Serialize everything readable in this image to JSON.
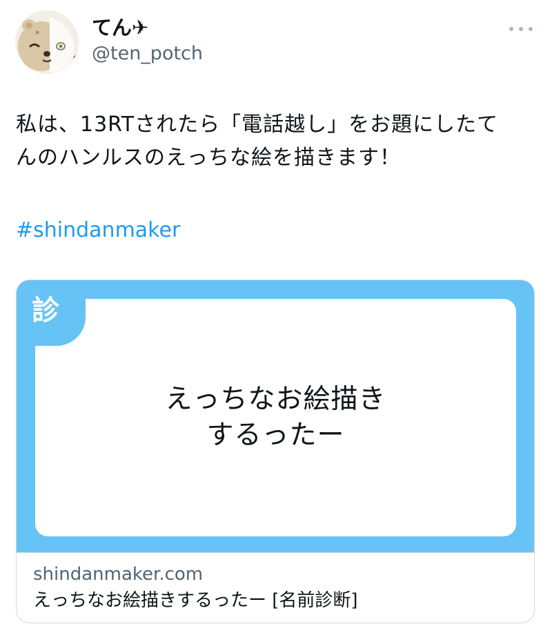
{
  "author": {
    "display_name": "てん✈",
    "handle": "@ten_potch",
    "avatar_icon": "bear-avatar-icon"
  },
  "more_icon": "ellipsis-icon",
  "tweet": {
    "text_line_1": "私は、13RTされたら「電話越し」をお題にしたて",
    "text_line_2": "んのハンルスのえっちな絵を描きます！",
    "hashtag": "#shindanmaker"
  },
  "card": {
    "badge": "診",
    "image_title_line_1": "えっちなお絵描き",
    "image_title_line_2": "するったー",
    "domain": "shindanmaker.com",
    "title": "えっちなお絵描きするったー [名前診断]",
    "accent_color": "#67c2f5"
  },
  "colors": {
    "link": "#1d9bf0",
    "secondary_text": "#536471",
    "primary_text": "#0f1419"
  }
}
